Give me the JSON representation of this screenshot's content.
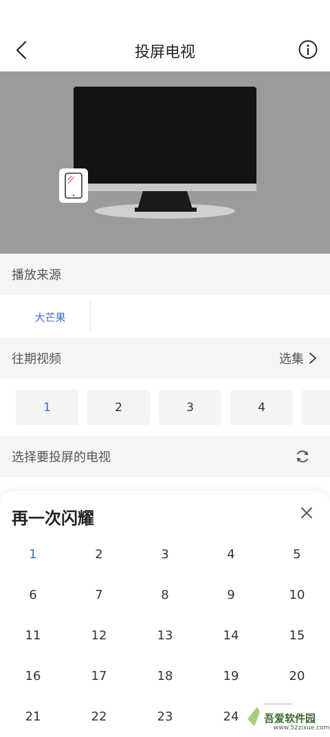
{
  "header": {
    "title": "投屏电视"
  },
  "source": {
    "section_title": "播放来源",
    "items": [
      "大芒果"
    ]
  },
  "episodes": {
    "section_title": "往期视频",
    "select_label": "选集",
    "chips": [
      "1",
      "2",
      "3",
      "4"
    ]
  },
  "tv_select": {
    "section_title": "选择要投屏的电视"
  },
  "sheet": {
    "title": "再一次闪耀",
    "episodes": [
      "1",
      "2",
      "3",
      "4",
      "5",
      "6",
      "7",
      "8",
      "9",
      "10",
      "11",
      "12",
      "13",
      "14",
      "15",
      "16",
      "17",
      "18",
      "19",
      "20",
      "21",
      "22",
      "23",
      "24"
    ]
  },
  "watermark": {
    "text": "吾爱软件园",
    "url": "www.52zixue.com"
  },
  "colors": {
    "accent": "#3b6fc8",
    "section_bg": "#f4f5f7",
    "tv_bg": "#9b9b9b"
  }
}
